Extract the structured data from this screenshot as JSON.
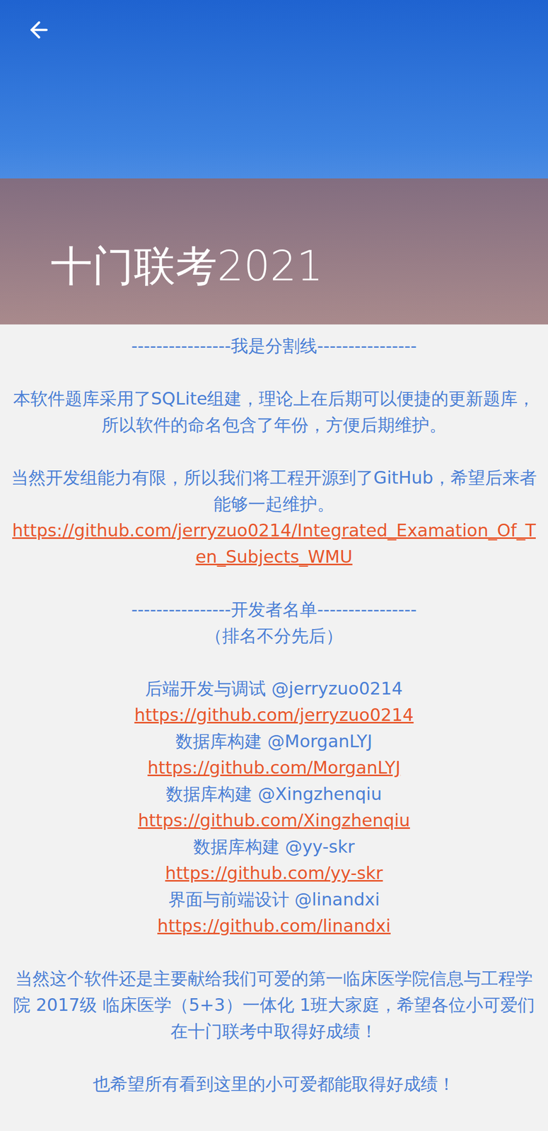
{
  "header": {
    "title": "十门联考2021"
  },
  "intro_divider": "----------------我是分割线----------------",
  "paragraphs": [
    "本软件题库采用了SQLite组建，理论上在后期可以便捷的更新题库，所以软件的命名包含了年份，方便后期维护。",
    "当然开发组能力有限，所以我们将工程开源到了GitHub，希望后来者能够一起维护。"
  ],
  "repo_link": "https://github.com/jerryzuo0214/Integrated_Examation_Of_Ten_Subjects_WMU",
  "developers_divider": "----------------开发者名单----------------",
  "developers_note": "（排名不分先后）",
  "developers": [
    {
      "role": "后端开发与调试",
      "handle": "@jerryzuo0214",
      "url": "https://github.com/jerryzuo0214"
    },
    {
      "role": "数据库构建",
      "handle": "@MorganLYJ",
      "url": "https://github.com/MorganLYJ"
    },
    {
      "role": "数据库构建",
      "handle": "@Xingzhenqiu",
      "url": "https://github.com/Xingzhenqiu"
    },
    {
      "role": "数据库构建",
      "handle": "@yy-skr",
      "url": "https://github.com/yy-skr"
    },
    {
      "role": "界面与前端设计",
      "handle": "@linandxi",
      "url": "https://github.com/linandxi"
    }
  ],
  "dedication": "当然这个软件还是主要献给我们可爱的第一临床医学院信息与工程学院 2017级 临床医学（5+3）一体化 1班大家庭，希望各位小可爱们在十门联考中取得好成绩！",
  "closing": "也希望所有看到这里的小可爱都能取得好成绩！"
}
